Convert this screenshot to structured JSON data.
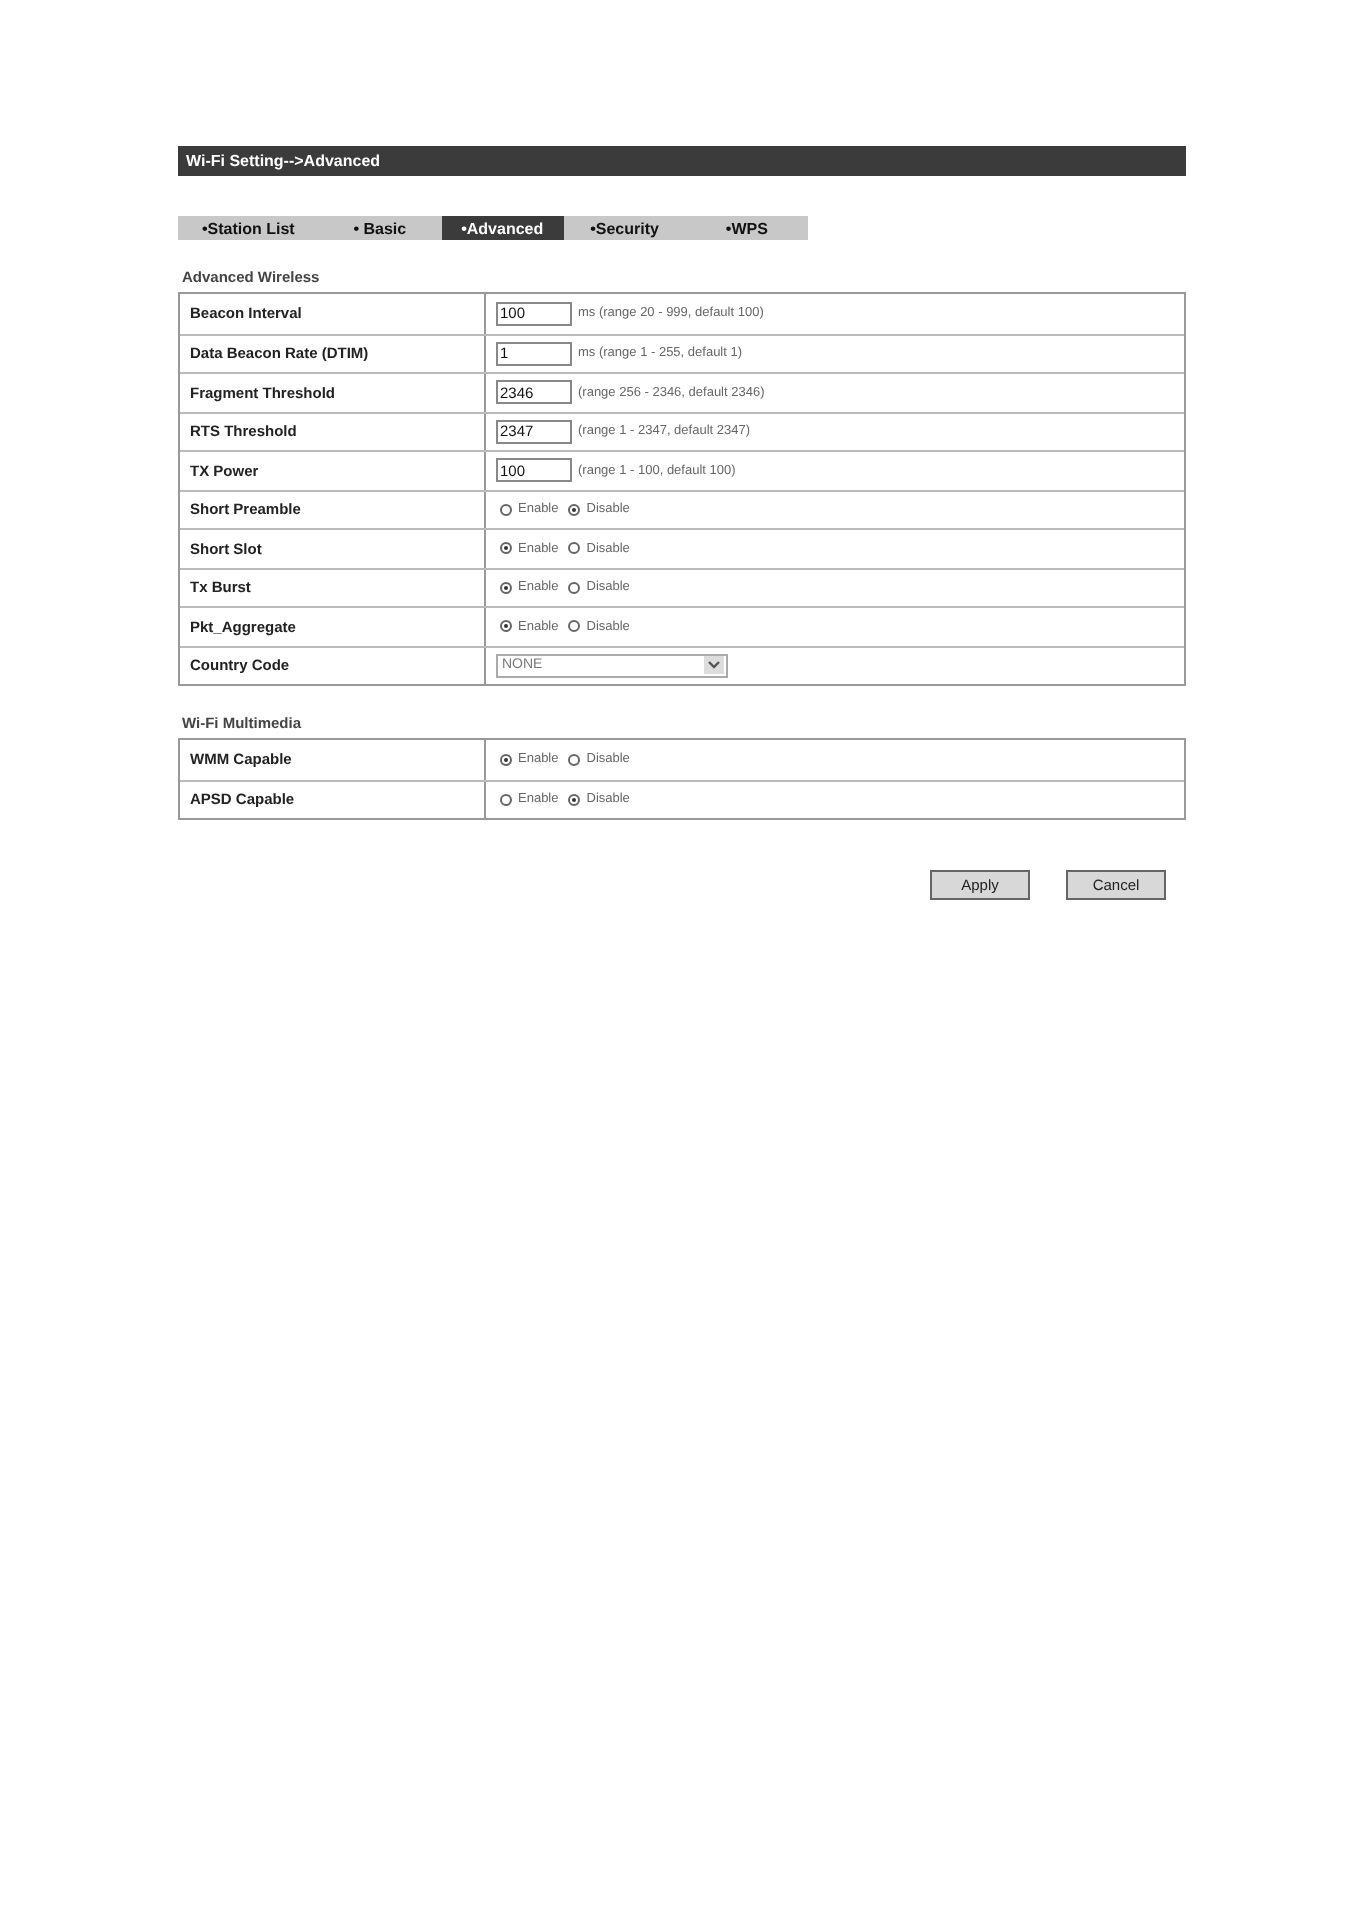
{
  "title_bar": {
    "title": "Wi-Fi Setting-->Advanced"
  },
  "tabs": [
    {
      "label": "•Station List",
      "selected": false
    },
    {
      "label": "• Basic",
      "selected": false
    },
    {
      "label": "•Advanced",
      "selected": true
    },
    {
      "label": "•Security",
      "selected": false
    },
    {
      "label": "•WPS",
      "selected": false
    }
  ],
  "sections": [
    {
      "heading": "Advanced Wireless",
      "rows": [
        {
          "kind": "text",
          "label": "Beacon Interval",
          "value": "100",
          "hint": "ms (range 20 - 999, default 100)"
        },
        {
          "kind": "text",
          "label": "Data Beacon Rate (DTIM)",
          "value": "1",
          "hint": "ms (range 1 - 255, default 1)"
        },
        {
          "kind": "text",
          "label": "Fragment Threshold",
          "value": "2346",
          "hint": "(range 256 - 2346, default 2346)"
        },
        {
          "kind": "text",
          "label": "RTS Threshold",
          "value": "2347",
          "hint": "(range 1 - 2347, default 2347)"
        },
        {
          "kind": "text",
          "label": "TX Power",
          "value": "100",
          "hint": "(range 1 - 100, default 100)"
        },
        {
          "kind": "radio",
          "label": "Short Preamble",
          "options": [
            {
              "label": "Enable",
              "selected": false
            },
            {
              "label": "Disable",
              "selected": true
            }
          ]
        },
        {
          "kind": "radio",
          "label": "Short Slot",
          "options": [
            {
              "label": "Enable",
              "selected": true
            },
            {
              "label": "Disable",
              "selected": false
            }
          ]
        },
        {
          "kind": "radio",
          "label": "Tx Burst",
          "options": [
            {
              "label": "Enable",
              "selected": true
            },
            {
              "label": "Disable",
              "selected": false
            }
          ]
        },
        {
          "kind": "radio",
          "label": "Pkt_Aggregate",
          "options": [
            {
              "label": "Enable",
              "selected": true
            },
            {
              "label": "Disable",
              "selected": false
            }
          ]
        },
        {
          "kind": "select",
          "label": "Country Code",
          "value": "NONE"
        }
      ]
    },
    {
      "heading": "Wi-Fi Multimedia",
      "rows": [
        {
          "kind": "radio",
          "label": "WMM Capable",
          "options": [
            {
              "label": "Enable",
              "selected": true
            },
            {
              "label": "Disable",
              "selected": false
            }
          ]
        },
        {
          "kind": "radio",
          "label": "APSD Capable",
          "options": [
            {
              "label": "Enable",
              "selected": false
            },
            {
              "label": "Disable",
              "selected": true
            }
          ]
        }
      ]
    }
  ],
  "buttons": [
    "Apply",
    "Cancel"
  ]
}
